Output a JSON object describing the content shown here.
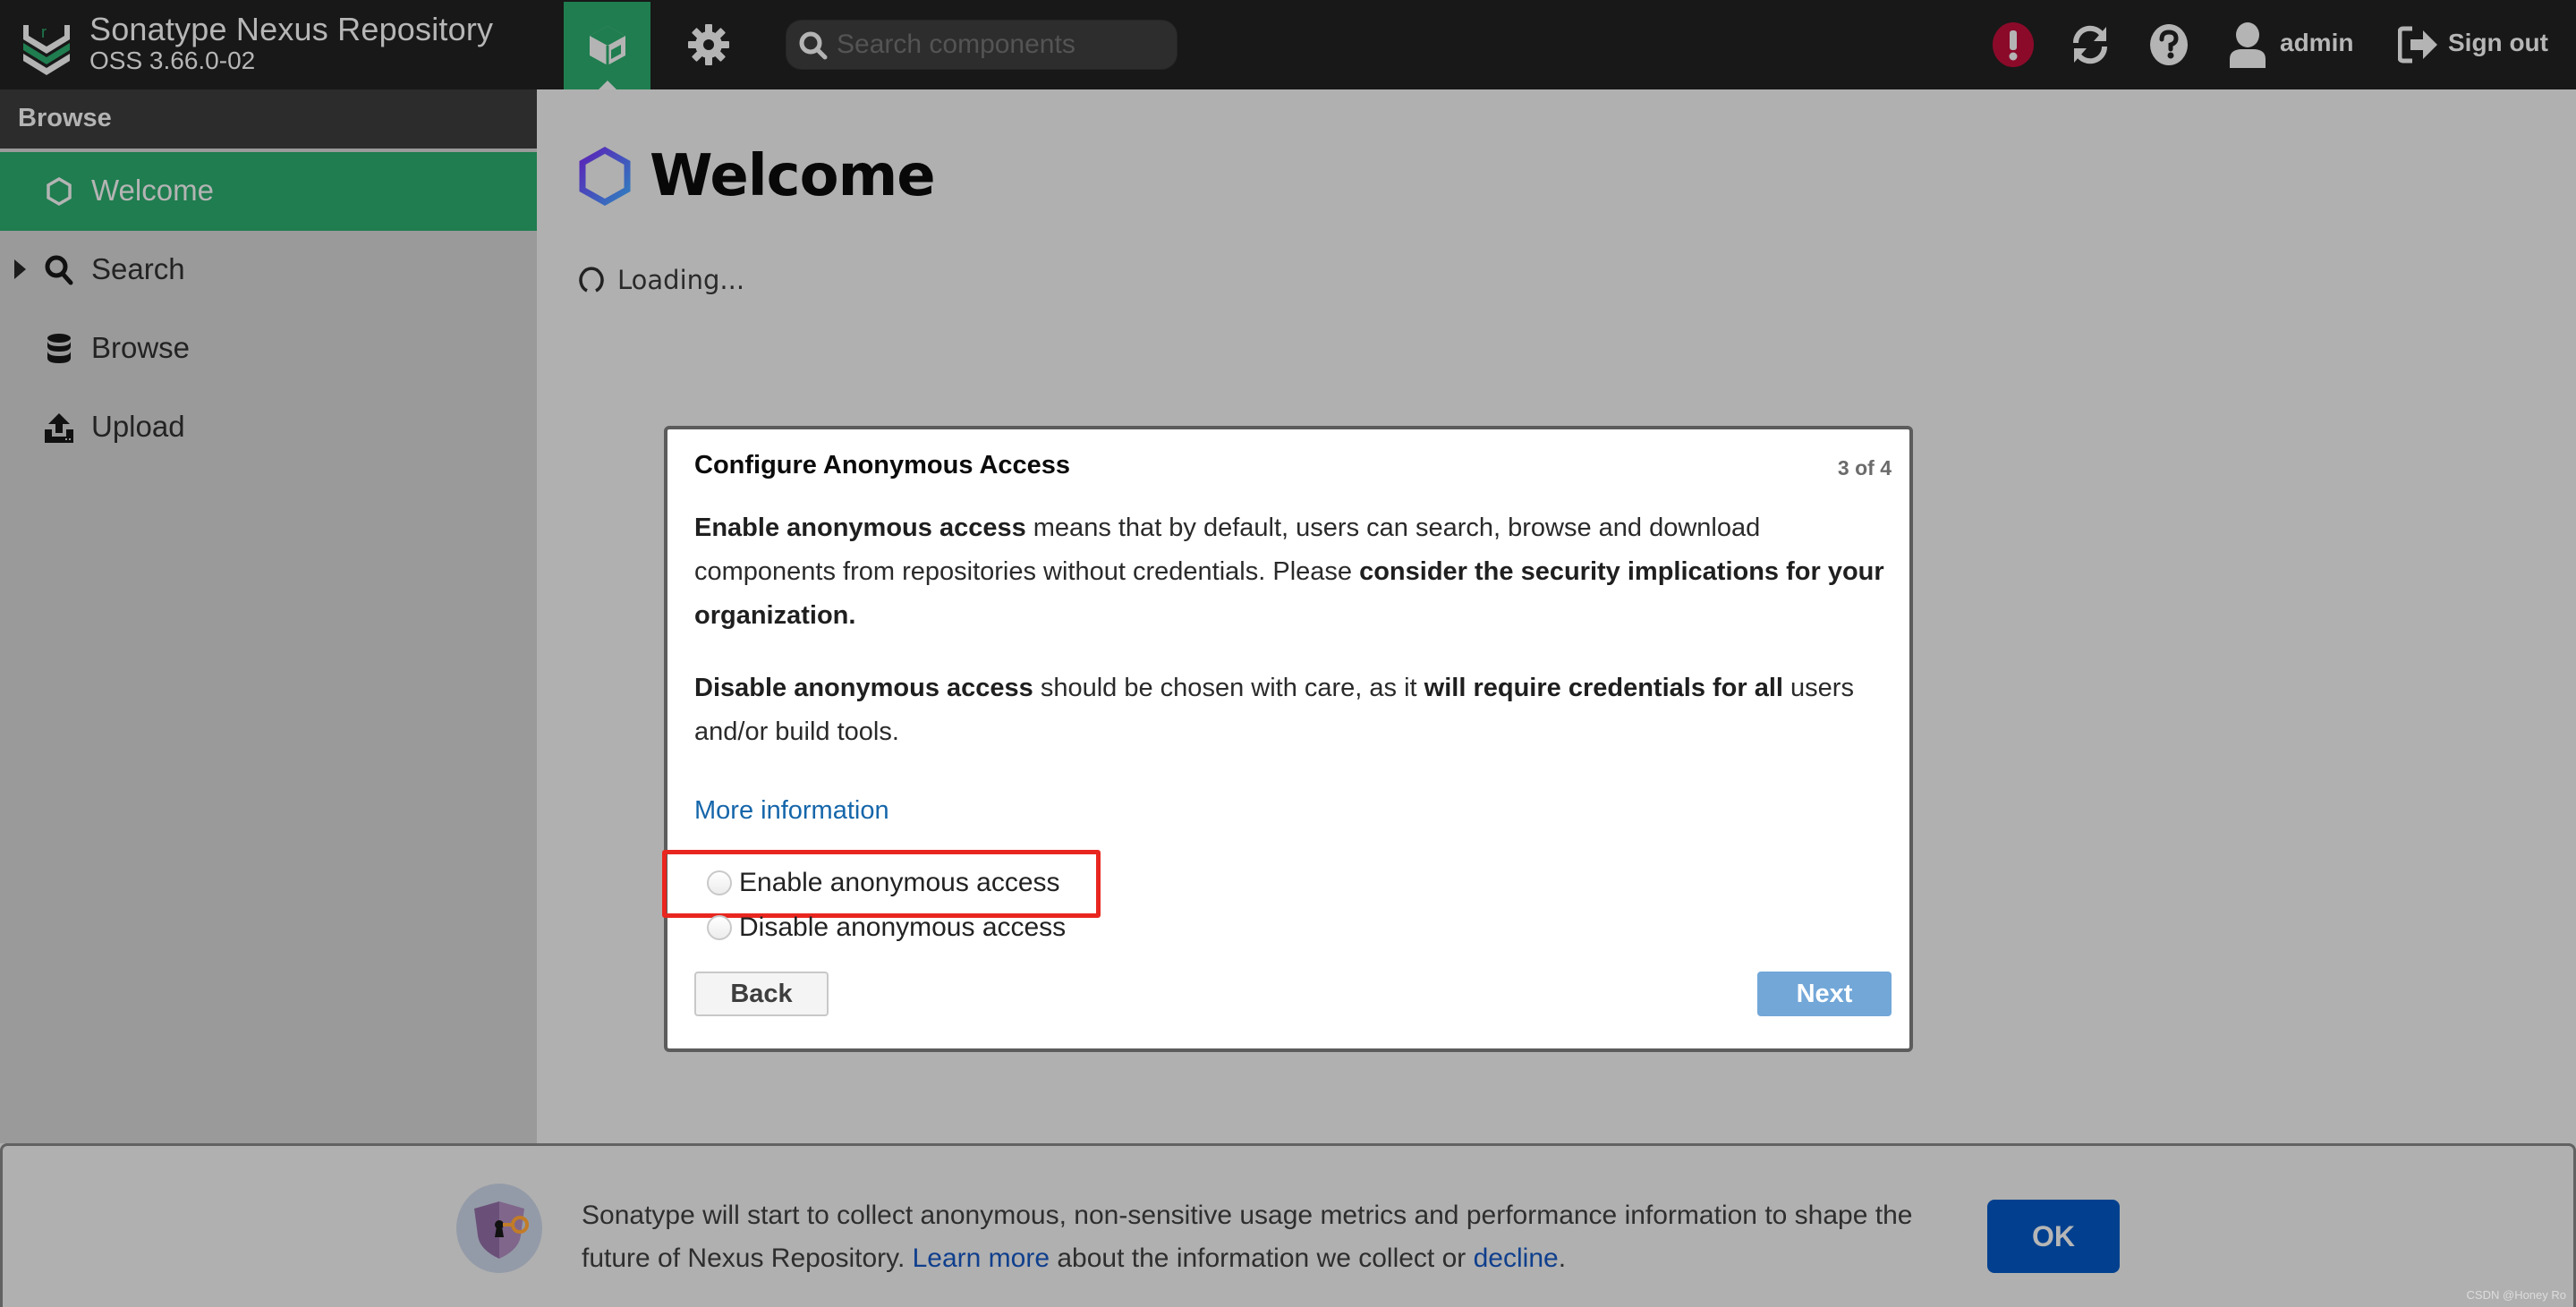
{
  "app": {
    "title": "Sonatype Nexus Repository",
    "version": "OSS 3.66.0-02"
  },
  "topbar": {
    "nav_browse_icon": "cube-icon",
    "nav_admin_icon": "gear-icon",
    "search": {
      "placeholder": "Search components",
      "value": ""
    },
    "alert_icon": "exclamation-circle-icon",
    "refresh_icon": "refresh-icon",
    "help_icon": "question-circle-icon",
    "user": {
      "name": "admin"
    },
    "signout_label": "Sign out",
    "colors": {
      "bar": "#181818",
      "active_tab": "#1f7d4f",
      "alert": "#8b0a2a"
    }
  },
  "sidebar": {
    "header": "Browse",
    "items": [
      {
        "label": "Welcome",
        "icon": "hexagon-icon",
        "active": true
      },
      {
        "label": "Search",
        "icon": "search-icon",
        "expandable": true
      },
      {
        "label": "Browse",
        "icon": "database-icon"
      },
      {
        "label": "Upload",
        "icon": "upload-icon"
      }
    ]
  },
  "main": {
    "title": "Welcome",
    "loading_text": "Loading..."
  },
  "wizard": {
    "title": "Configure Anonymous Access",
    "step": "3 of 4",
    "para1": {
      "b1": "Enable anonymous access",
      "t1": " means that by default, users can search, browse and download components from repositories without credentials. Please ",
      "b2": "consider the security implications for your organization."
    },
    "para2": {
      "b1": "Disable anonymous access",
      "t1": " should be chosen with care, as it ",
      "b2": "will require credentials for all",
      "t2": " users and/or build tools."
    },
    "more_info": "More information",
    "options": [
      {
        "label": "Enable anonymous access",
        "checked": false,
        "highlighted": true
      },
      {
        "label": "Disable anonymous access",
        "checked": false
      }
    ],
    "back_label": "Back",
    "next_label": "Next"
  },
  "banner": {
    "text1": "Sonatype will start to collect anonymous, non-sensitive usage metrics and performance information to shape the future of Nexus Repository. ",
    "learn_more": "Learn more",
    "text2": " about the information we collect or ",
    "decline": "decline",
    "text3": ".",
    "ok_label": "OK",
    "icon": "shield-key-icon"
  },
  "watermark": "CSDN @Honey Ro"
}
